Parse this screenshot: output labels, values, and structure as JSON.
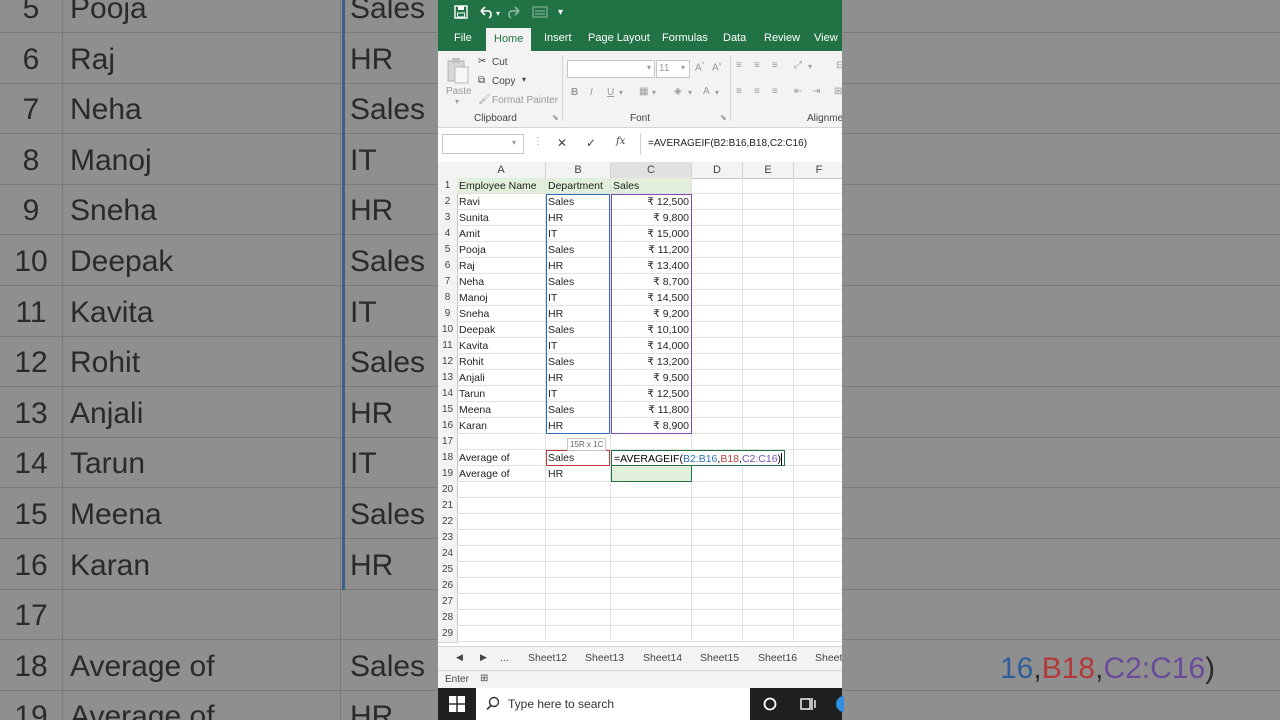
{
  "background": {
    "rows": [
      {
        "num": "5",
        "name": "Pooja",
        "dept": "Sales"
      },
      {
        "num": "6",
        "name": "Raj",
        "dept": "HR"
      },
      {
        "num": "7",
        "name": "Neha",
        "dept": "Sales"
      },
      {
        "num": "8",
        "name": "Manoj",
        "dept": "IT"
      },
      {
        "num": "9",
        "name": "Sneha",
        "dept": "HR"
      },
      {
        "num": "10",
        "name": "Deepak",
        "dept": "Sales"
      },
      {
        "num": "11",
        "name": "Kavita",
        "dept": "IT"
      },
      {
        "num": "12",
        "name": "Rohit",
        "dept": "Sales"
      },
      {
        "num": "13",
        "name": "Anjali",
        "dept": "HR"
      },
      {
        "num": "14",
        "name": "Tarun",
        "dept": "IT"
      },
      {
        "num": "15",
        "name": "Meena",
        "dept": "Sales"
      },
      {
        "num": "16",
        "name": "Karan",
        "dept": "HR"
      },
      {
        "num": "17",
        "name": "",
        "dept": ""
      },
      {
        "num": "18",
        "name": "Average of",
        "dept": "Sales"
      },
      {
        "num": "19",
        "name": "Average of",
        "dept": "HR"
      }
    ],
    "formula_tail_ref1": "16",
    "formula_tail_sep1": ",",
    "formula_tail_ref2": "B18",
    "formula_tail_sep2": ",",
    "formula_tail_ref3": "C2:C16",
    "formula_tail_close": ")"
  },
  "tabs": [
    "File",
    "Home",
    "Insert",
    "Page Layout",
    "Formulas",
    "Data",
    "Review",
    "View"
  ],
  "active_tab": "Home",
  "ribbon": {
    "paste": "Paste",
    "cut": "Cut",
    "copy": "Copy",
    "format_painter": "Format Painter",
    "clipboard": "Clipboard",
    "font_size": "11",
    "font_label": "Font",
    "alignment_label": "Alignmen",
    "bold": "B",
    "italic": "I",
    "underline": "U"
  },
  "formula_bar": {
    "name_box": "",
    "fx": "fx",
    "formula": "=AVERAGEIF(B2:B16,B18,C2:C16)"
  },
  "columns": [
    "A",
    "B",
    "C",
    "D",
    "E",
    "F"
  ],
  "rows": [
    {
      "n": "1",
      "a": "Employee Name",
      "b": "Department",
      "c": "Sales"
    },
    {
      "n": "2",
      "a": "Ravi",
      "b": "Sales",
      "c": "₹ 12,500"
    },
    {
      "n": "3",
      "a": "Sunita",
      "b": "HR",
      "c": "₹ 9,800"
    },
    {
      "n": "4",
      "a": "Amit",
      "b": "IT",
      "c": "₹ 15,000"
    },
    {
      "n": "5",
      "a": "Pooja",
      "b": "Sales",
      "c": "₹ 11,200"
    },
    {
      "n": "6",
      "a": "Raj",
      "b": "HR",
      "c": "₹ 13,400"
    },
    {
      "n": "7",
      "a": "Neha",
      "b": "Sales",
      "c": "₹ 8,700"
    },
    {
      "n": "8",
      "a": "Manoj",
      "b": "IT",
      "c": "₹ 14,500"
    },
    {
      "n": "9",
      "a": "Sneha",
      "b": "HR",
      "c": "₹ 9,200"
    },
    {
      "n": "10",
      "a": "Deepak",
      "b": "Sales",
      "c": "₹ 10,100"
    },
    {
      "n": "11",
      "a": "Kavita",
      "b": "IT",
      "c": "₹ 14,000"
    },
    {
      "n": "12",
      "a": "Rohit",
      "b": "Sales",
      "c": "₹ 13,200"
    },
    {
      "n": "13",
      "a": "Anjali",
      "b": "HR",
      "c": "₹ 9,500"
    },
    {
      "n": "14",
      "a": "Tarun",
      "b": "IT",
      "c": "₹ 12,500"
    },
    {
      "n": "15",
      "a": "Meena",
      "b": "Sales",
      "c": "₹ 11,800"
    },
    {
      "n": "16",
      "a": "Karan",
      "b": "HR",
      "c": "₹ 8,900"
    },
    {
      "n": "17",
      "a": "",
      "b": "",
      "c": ""
    },
    {
      "n": "18",
      "a": "Average of",
      "b": "Sales",
      "c": ""
    },
    {
      "n": "19",
      "a": "Average of",
      "b": "HR",
      "c": ""
    },
    {
      "n": "20",
      "a": "",
      "b": "",
      "c": ""
    },
    {
      "n": "21",
      "a": "",
      "b": "",
      "c": ""
    },
    {
      "n": "22",
      "a": "",
      "b": "",
      "c": ""
    },
    {
      "n": "23",
      "a": "",
      "b": "",
      "c": ""
    },
    {
      "n": "24",
      "a": "",
      "b": "",
      "c": ""
    },
    {
      "n": "25",
      "a": "",
      "b": "",
      "c": ""
    },
    {
      "n": "26",
      "a": "",
      "b": "",
      "c": ""
    },
    {
      "n": "27",
      "a": "",
      "b": "",
      "c": ""
    },
    {
      "n": "28",
      "a": "",
      "b": "",
      "c": ""
    },
    {
      "n": "29",
      "a": "",
      "b": "",
      "c": ""
    }
  ],
  "edit_formula": {
    "fn": "=AVERAGEIF(",
    "ref1": "B2:B16",
    "sep1": ",",
    "ref2": "B18",
    "sep2": ",",
    "ref3": "C2:C16",
    "close": ")"
  },
  "range_tooltip": "15R x 1C",
  "sheets": [
    "Sheet12",
    "Sheet13",
    "Sheet14",
    "Sheet15",
    "Sheet16",
    "Sheet"
  ],
  "sheet_ellipsis": "...",
  "status": "Enter",
  "taskbar": {
    "search_placeholder": "Type here to search"
  },
  "colors": {
    "excel_green": "#217346",
    "ref_blue": "#2f6fb5",
    "ref_red": "#c43b3b",
    "ref_purple": "#7b4fb0",
    "header_fill": "#e2efda"
  }
}
